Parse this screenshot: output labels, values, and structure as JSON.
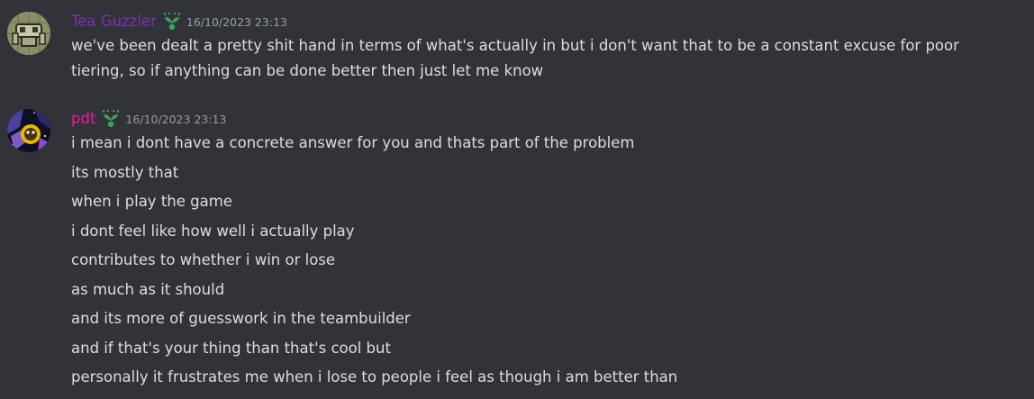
{
  "messages": [
    {
      "username": "Tea Guzzler",
      "username_color": "#7e2fb6",
      "role_icon": "sprout-icon",
      "timestamp": "16/10/2023 23:13",
      "avatar_icon": "robot-avatar",
      "lines": [
        "we've been dealt a pretty shit hand in terms of what's actually in but i don't want that to be a constant excuse for poor",
        "tiering, so if anything can be done better then just let me know"
      ]
    },
    {
      "username": "pdt",
      "username_color": "#e91e9c",
      "role_icon": "sprout-icon",
      "timestamp": "16/10/2023 23:13",
      "avatar_icon": "space-avatar",
      "lines": [
        "i mean i dont have a concrete answer for you and thats part of the problem",
        "its mostly that",
        "when i play the game",
        "i dont feel like how well i actually play",
        "contributes to whether i win or lose",
        "as much as it should",
        "and its more of guesswork in the teambuilder",
        "and if that's your thing than that's cool but",
        "personally it frustrates me when i lose to people i feel as though i am better than"
      ]
    }
  ],
  "colors": {
    "background": "#313338",
    "text": "#dbdee1",
    "timestamp": "#949ba4",
    "role_icon": "#3ba55c"
  }
}
